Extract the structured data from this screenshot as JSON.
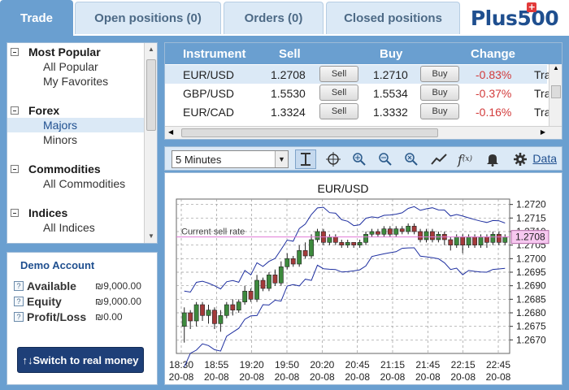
{
  "tabs": [
    {
      "label": "Trade",
      "active": true
    },
    {
      "label": "Open positions (0)",
      "active": false
    },
    {
      "label": "Orders (0)",
      "active": false
    },
    {
      "label": "Closed positions",
      "active": false
    }
  ],
  "logo": {
    "text": "Plus500"
  },
  "menu": {
    "groups": [
      {
        "title": "Most Popular",
        "items": [
          "All Popular",
          "My Favorites"
        ]
      },
      {
        "title": "Forex",
        "items": [
          "Majors",
          "Minors"
        ],
        "selected": "Majors"
      },
      {
        "title": "Commodities",
        "items": [
          "All Commodities"
        ]
      },
      {
        "title": "Indices",
        "items": [
          "All Indices"
        ]
      }
    ]
  },
  "account": {
    "title": "Demo Account",
    "rows": [
      {
        "label": "Available",
        "value": "₪9,000.00"
      },
      {
        "label": "Equity",
        "value": "₪9,000.00"
      },
      {
        "label": "Profit/Loss",
        "value": "₪0.00"
      }
    ],
    "switch_label": "↑↓Switch to real money"
  },
  "table": {
    "headers": {
      "instrument": "Instrument",
      "sell": "Sell",
      "buy": "Buy",
      "change": "Change"
    },
    "sell_btn": "Sell",
    "buy_btn": "Buy",
    "trade_truncated": "Tra",
    "rows": [
      {
        "instrument": "EUR/USD",
        "sell": "1.2708",
        "buy": "1.2710",
        "change": "-0.83%"
      },
      {
        "instrument": "GBP/USD",
        "sell": "1.5530",
        "buy": "1.5534",
        "change": "-0.37%"
      },
      {
        "instrument": "EUR/CAD",
        "sell": "1.3324",
        "buy": "1.3332",
        "change": "-0.16%"
      }
    ]
  },
  "toolbar": {
    "timeframe": "5 Minutes",
    "data_link": "Data",
    "tools": [
      "cursor-tool-icon",
      "crosshair-icon",
      "zoom-in-icon",
      "zoom-out-icon",
      "zoom-reset-icon",
      "line-chart-icon",
      "function-icon",
      "alert-bell-icon",
      "settings-gear-icon"
    ]
  },
  "chart_data": {
    "type": "candlestick",
    "title": "EUR/USD",
    "annotation": "Current sell rate",
    "current_value": "1.2708",
    "ylim": [
      1.2665,
      1.2722
    ],
    "yticks": [
      "1.2720",
      "1.2715",
      "1.2710",
      "1.2705",
      "1.2700",
      "1.2695",
      "1.2690",
      "1.2685",
      "1.2680",
      "1.2675",
      "1.2670"
    ],
    "xticks": [
      {
        "time": "18:30",
        "date": "20-08"
      },
      {
        "time": "18:55",
        "date": "20-08"
      },
      {
        "time": "19:20",
        "date": "20-08"
      },
      {
        "time": "19:50",
        "date": "20-08"
      },
      {
        "time": "20:20",
        "date": "20-08"
      },
      {
        "time": "20:45",
        "date": "20-08"
      },
      {
        "time": "21:15",
        "date": "20-08"
      },
      {
        "time": "21:45",
        "date": "20-08"
      },
      {
        "time": "22:15",
        "date": "20-08"
      },
      {
        "time": "22:45",
        "date": "20-08"
      }
    ],
    "candles": [
      [
        1.2675,
        1.268,
        1.2669,
        1.2682
      ],
      [
        1.268,
        1.2677,
        1.2674,
        1.2681
      ],
      [
        1.2677,
        1.2683,
        1.2675,
        1.2684
      ],
      [
        1.2683,
        1.2679,
        1.2677,
        1.2684
      ],
      [
        1.2679,
        1.2681,
        1.2676,
        1.2683
      ],
      [
        1.2681,
        1.2676,
        1.2674,
        1.2682
      ],
      [
        1.2676,
        1.2679,
        1.2673,
        1.2681
      ],
      [
        1.2679,
        1.2683,
        1.2678,
        1.2684
      ],
      [
        1.2683,
        1.2681,
        1.2679,
        1.2685
      ],
      [
        1.2681,
        1.2684,
        1.268,
        1.2685
      ],
      [
        1.2684,
        1.2688,
        1.2683,
        1.269
      ],
      [
        1.2688,
        1.2685,
        1.2684,
        1.2689
      ],
      [
        1.2685,
        1.2692,
        1.2684,
        1.2694
      ],
      [
        1.2692,
        1.2689,
        1.2688,
        1.2693
      ],
      [
        1.2689,
        1.2694,
        1.2688,
        1.2695
      ],
      [
        1.2694,
        1.2691,
        1.269,
        1.2696
      ],
      [
        1.2691,
        1.2697,
        1.269,
        1.2699
      ],
      [
        1.2697,
        1.27,
        1.2696,
        1.2702
      ],
      [
        1.27,
        1.2698,
        1.2697,
        1.2701
      ],
      [
        1.2698,
        1.2703,
        1.2697,
        1.2705
      ],
      [
        1.2703,
        1.2701,
        1.27,
        1.2706
      ],
      [
        1.2701,
        1.2707,
        1.27,
        1.2709
      ],
      [
        1.2707,
        1.271,
        1.2706,
        1.2711
      ],
      [
        1.271,
        1.2706,
        1.2705,
        1.2711
      ],
      [
        1.2706,
        1.2708,
        1.2705,
        1.2709
      ],
      [
        1.2708,
        1.2706,
        1.2705,
        1.2709
      ],
      [
        1.2706,
        1.2705,
        1.2704,
        1.2707
      ],
      [
        1.2705,
        1.2706,
        1.2704,
        1.2707
      ],
      [
        1.2706,
        1.2705,
        1.2704,
        1.2706
      ],
      [
        1.2705,
        1.2706,
        1.2704,
        1.2707
      ],
      [
        1.2706,
        1.2709,
        1.2705,
        1.271
      ],
      [
        1.2709,
        1.271,
        1.2708,
        1.2711
      ],
      [
        1.271,
        1.2709,
        1.2708,
        1.2711
      ],
      [
        1.2709,
        1.2711,
        1.2708,
        1.2712
      ],
      [
        1.2711,
        1.2709,
        1.2708,
        1.2712
      ],
      [
        1.2709,
        1.2711,
        1.2708,
        1.2712
      ],
      [
        1.2711,
        1.271,
        1.2709,
        1.2712
      ],
      [
        1.271,
        1.2712,
        1.2709,
        1.2713
      ],
      [
        1.2712,
        1.271,
        1.2709,
        1.2713
      ],
      [
        1.271,
        1.2707,
        1.2706,
        1.2711
      ],
      [
        1.2707,
        1.271,
        1.2706,
        1.2711
      ],
      [
        1.271,
        1.2707,
        1.2706,
        1.2711
      ],
      [
        1.2707,
        1.2709,
        1.2706,
        1.271
      ],
      [
        1.2709,
        1.2707,
        1.2705,
        1.271
      ],
      [
        1.2707,
        1.2705,
        1.2703,
        1.2708
      ],
      [
        1.2705,
        1.2708,
        1.2704,
        1.2709
      ],
      [
        1.2708,
        1.2705,
        1.2702,
        1.2709
      ],
      [
        1.2705,
        1.2708,
        1.2704,
        1.2709
      ],
      [
        1.2708,
        1.2705,
        1.2704,
        1.2709
      ],
      [
        1.2705,
        1.2708,
        1.2704,
        1.2709
      ],
      [
        1.2708,
        1.2706,
        1.2704,
        1.2709
      ],
      [
        1.2706,
        1.2709,
        1.2705,
        1.271
      ],
      [
        1.2709,
        1.2706,
        1.2705,
        1.271
      ],
      [
        1.2706,
        1.2708,
        1.2705,
        1.2709
      ]
    ]
  }
}
